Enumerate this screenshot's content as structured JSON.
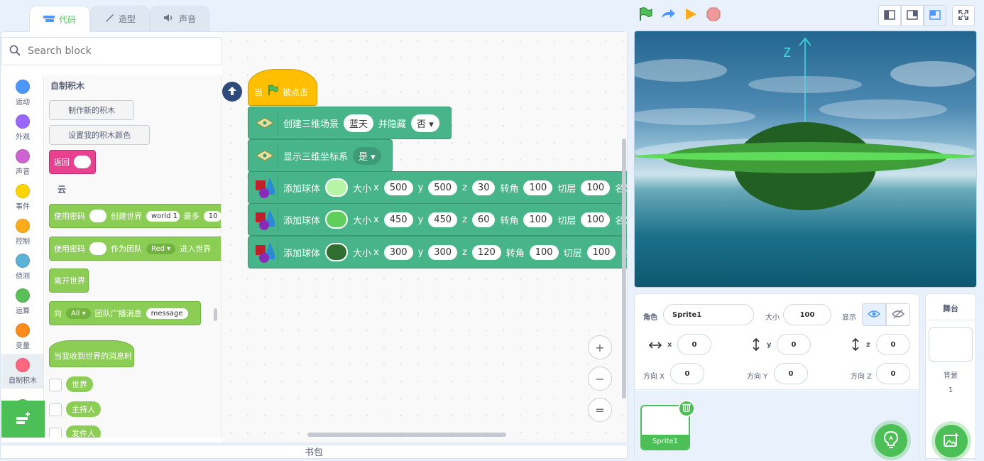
{
  "tabs": [
    {
      "label": "代码",
      "icon": "code-icon"
    },
    {
      "label": "造型",
      "icon": "brush-icon"
    },
    {
      "label": "声音",
      "icon": "speaker-icon"
    }
  ],
  "search": {
    "placeholder": "Search block"
  },
  "categories": [
    {
      "label": "运动",
      "color": "#4c97ff"
    },
    {
      "label": "外观",
      "color": "#9966ff"
    },
    {
      "label": "声音",
      "color": "#cf63cf"
    },
    {
      "label": "事件",
      "color": "#ffd500"
    },
    {
      "label": "控制",
      "color": "#ffab19"
    },
    {
      "label": "侦测",
      "color": "#5cb1d6"
    },
    {
      "label": "运算",
      "color": "#59c059"
    },
    {
      "label": "变量",
      "color": "#ff8c1a"
    },
    {
      "label": "自制积木",
      "color": "#ff6680"
    }
  ],
  "palette": {
    "title": "自制积木",
    "make_block": "制作新的积木",
    "set_color": "设置我的积木颜色",
    "return_label": "返回",
    "cloud_heading": "云",
    "b1": {
      "a": "使用密码",
      "b": "创建世界",
      "c": "world 1",
      "d": "最多",
      "e": "10"
    },
    "b2": {
      "a": "使用密码",
      "b": "作为团队",
      "c": "Red",
      "d": "进入世界"
    },
    "b3": "离开世界",
    "b4": {
      "a": "向",
      "b": "All",
      "c": "团队广播消息",
      "d": "message"
    },
    "b5": "当我收到世界的消息时",
    "vars": [
      "世界",
      "主持人",
      "发件人"
    ]
  },
  "script": {
    "hat": {
      "a": "当",
      "b": "被点击"
    },
    "b1": {
      "label": "创建三维场景",
      "value": "蓝天",
      "label2": "并隐藏",
      "dd": "否"
    },
    "b2": {
      "label": "显示三维坐标系",
      "dd": "是"
    },
    "spheres": [
      {
        "label": "添加球体",
        "color": "#b6f5a6",
        "size": "大小",
        "x_lbl": "x",
        "x": "500",
        "y_lbl": "y",
        "y": "500",
        "z_lbl": "z",
        "z": "30",
        "rot": "转角",
        "rv": "100",
        "cut": "切层",
        "cv": "100",
        "name": "名为"
      },
      {
        "label": "添加球体",
        "color": "#5fcf5c",
        "size": "大小",
        "x_lbl": "x",
        "x": "450",
        "y_lbl": "y",
        "y": "450",
        "z_lbl": "z",
        "z": "60",
        "rot": "转角",
        "rv": "100",
        "cut": "切层",
        "cv": "100",
        "name": "名为"
      },
      {
        "label": "添加球体",
        "color": "#2f6e2f",
        "size": "大小",
        "x_lbl": "x",
        "x": "300",
        "y_lbl": "y",
        "y": "300",
        "z_lbl": "z",
        "z": "120",
        "rot": "转角",
        "rv": "100",
        "cut": "切层",
        "cv": "100",
        "name": "名"
      }
    ]
  },
  "zoom": {
    "in": "+",
    "out": "−",
    "reset": "="
  },
  "backpack": "书包",
  "stage_axis_label": "Z",
  "sprite_info": {
    "sprite_label": "角色",
    "sprite_name": "Sprite1",
    "size_label": "大小",
    "size": "100",
    "show_label": "显示",
    "x_label": "x",
    "x": "0",
    "y_label": "y",
    "y": "0",
    "z_label": "z",
    "z": "0",
    "dir_x_label": "方向 X",
    "dir_x": "0",
    "dir_y_label": "方向 Y",
    "dir_y": "0",
    "dir_z_label": "方向 Z",
    "dir_z": "0"
  },
  "sprites": [
    {
      "name": "Sprite1"
    }
  ],
  "stage_panel": {
    "title": "舞台",
    "backdrop_label": "背景",
    "backdrop_count": "1"
  }
}
